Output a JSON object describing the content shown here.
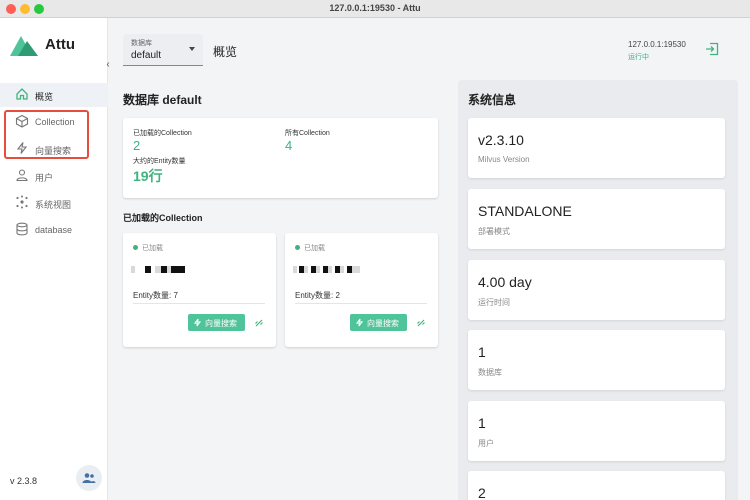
{
  "window": {
    "title": "127.0.0.1:19530 - Attu"
  },
  "sidebar": {
    "app_name": "Attu",
    "items": [
      {
        "label": "概览",
        "icon": "home-icon",
        "active": true
      },
      {
        "label": "Collection",
        "icon": "cube-icon",
        "active": false
      },
      {
        "label": "向量搜索",
        "icon": "lightning-icon",
        "active": false
      },
      {
        "label": "用户",
        "icon": "user-icon",
        "active": false
      },
      {
        "label": "系统视图",
        "icon": "network-icon",
        "active": false
      },
      {
        "label": "database",
        "icon": "database-icon",
        "active": false
      }
    ],
    "version": "v 2.3.8"
  },
  "header": {
    "db_select_label": "数据库",
    "db_select_value": "default",
    "page_title": "概览",
    "server_address": "127.0.0.1:19530",
    "server_status": "运行中"
  },
  "overview": {
    "heading": "数据库 default",
    "stats": {
      "loaded_label": "已加载的Collection",
      "loaded_value": "2",
      "all_label": "所有Collection",
      "all_value": "4",
      "entity_label": "大约的Entity数量",
      "entity_value": "19行"
    },
    "loaded_heading": "已加载的Collection",
    "collections": [
      {
        "state": "已加载",
        "count": "Entity数量: 7",
        "search_label": "向量搜索"
      },
      {
        "state": "已加载",
        "count": "Entity数量: 2",
        "search_label": "向量搜索"
      }
    ]
  },
  "system_info": {
    "heading": "系统信息",
    "items": [
      {
        "value": "v2.3.10",
        "label": "Milvus Version"
      },
      {
        "value": "STANDALONE",
        "label": "部署模式"
      },
      {
        "value": "4.00 day",
        "label": "运行时间"
      },
      {
        "value": "1",
        "label": "数据库"
      },
      {
        "value": "1",
        "label": "用户"
      },
      {
        "value": "2",
        "label": ""
      }
    ]
  },
  "colors": {
    "accent": "#3fb27f",
    "button": "#4fc39a",
    "highlight": "#e74c3c"
  }
}
